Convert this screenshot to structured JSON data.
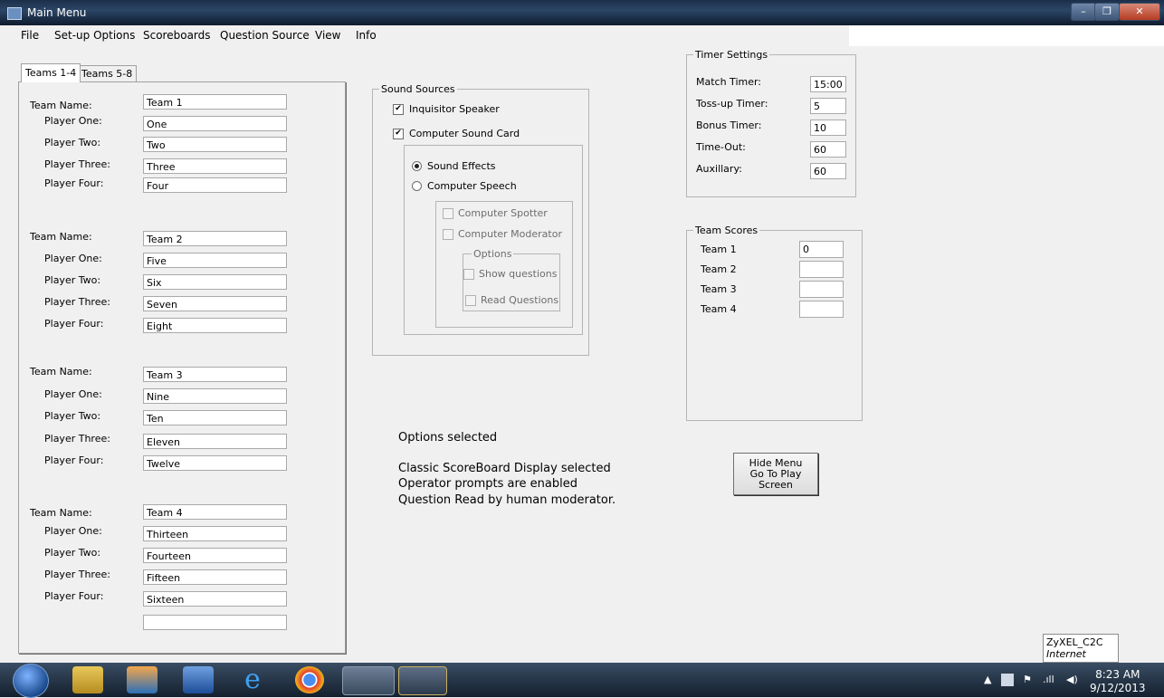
{
  "window": {
    "title": "Main Menu",
    "minimize": "–",
    "maximize": "❐",
    "close": "✕"
  },
  "menu": [
    "File",
    "Set-up Options",
    "Scoreboards",
    "Question Source",
    "View",
    "Info"
  ],
  "tabs": [
    "Teams 1-4",
    "Teams 5-8"
  ],
  "team_labels": {
    "team_name": "Team Name:",
    "p1": "Player One:",
    "p2": "Player Two:",
    "p3": "Player Three:",
    "p4": "Player Four:"
  },
  "teams": [
    {
      "name": "Team 1",
      "players": [
        "One",
        "Two",
        "Three",
        "Four"
      ]
    },
    {
      "name": "Team 2",
      "players": [
        "Five",
        "Six",
        "Seven",
        "Eight"
      ]
    },
    {
      "name": "Team 3",
      "players": [
        "Nine",
        "Ten",
        "Eleven",
        "Twelve"
      ]
    },
    {
      "name": "Team 4",
      "players": [
        "Thirteen",
        "Fourteen",
        "Fifteen",
        "Sixteen"
      ]
    }
  ],
  "extra_field": "",
  "sound": {
    "title": "Sound Sources",
    "inquisitor": "Inquisitor Speaker",
    "soundcard": "Computer Sound Card",
    "effects": "Sound Effects",
    "speech": "Computer Speech",
    "spotter": "Computer Spotter",
    "moderator": "Computer Moderator",
    "options_title": "Options",
    "show_q": "Show questions",
    "read_q": "Read Questions",
    "inquisitor_checked": true,
    "soundcard_checked": true,
    "selected_radio": "Sound Effects"
  },
  "timer": {
    "title": "Timer Settings",
    "items": [
      {
        "label": "Match Timer:",
        "value": "15:00"
      },
      {
        "label": "Toss-up Timer:",
        "value": "5"
      },
      {
        "label": "Bonus Timer:",
        "value": "10"
      },
      {
        "label": "Time-Out:",
        "value": "60"
      },
      {
        "label": "Auxillary:",
        "value": "60"
      }
    ]
  },
  "scores": {
    "title": "Team Scores",
    "items": [
      {
        "label": "Team 1",
        "value": "0"
      },
      {
        "label": "Team 2",
        "value": ""
      },
      {
        "label": "Team 3",
        "value": ""
      },
      {
        "label": "Team 4",
        "value": ""
      }
    ]
  },
  "options_text": {
    "heading": "Options  selected",
    "line1": "Classic  ScoreBoard  Display  selected",
    "line2": "Operator  prompts  are  enabled",
    "line3": "Question  Read  by  human  moderator."
  },
  "hide_button": {
    "line1": "Hide Menu",
    "line2": "Go To Play",
    "line3": "Screen"
  },
  "tooltip": {
    "network": "ZyXEL_C2C",
    "status": "Internet access"
  },
  "clock": {
    "time": "8:23 AM",
    "date": "9/12/2013"
  },
  "tray": {
    "up": "▲",
    "signal": ".ıll",
    "volume": "◀)"
  },
  "taskbar_icons": [
    "explorer-icon",
    "media-player-icon",
    "word-icon",
    "ie-icon",
    "chrome-icon",
    "visual-studio-icon",
    "app-icon"
  ]
}
